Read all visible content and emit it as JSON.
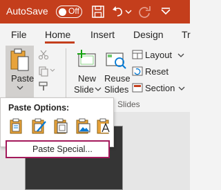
{
  "titlebar": {
    "autosave_label": "AutoSave",
    "autosave_state": "Off",
    "icons": [
      "save-icon",
      "undo-icon",
      "undo-dropdown-icon",
      "redo-icon",
      "more-icon"
    ]
  },
  "tabs": [
    "File",
    "Home",
    "Insert",
    "Design",
    "Tr"
  ],
  "active_tab": "Home",
  "ribbon": {
    "paste_label": "Paste",
    "new_slide_label_1": "New",
    "new_slide_label_2": "Slide",
    "reuse_slides_label_1": "Reuse",
    "reuse_slides_label_2": "Slides",
    "layout_label": "Layout",
    "reset_label": "Reset",
    "section_label": "Section",
    "group_label": "Slides"
  },
  "paste_menu": {
    "title": "Paste Options:",
    "options": [
      "use-destination-theme-icon",
      "keep-source-formatting-icon",
      "embed-icon",
      "picture-icon",
      "keep-text-only-icon"
    ],
    "paste_special_label": "Paste Special..."
  },
  "colors": {
    "brand": "#c43e1c",
    "focus_border": "#a3195b"
  }
}
